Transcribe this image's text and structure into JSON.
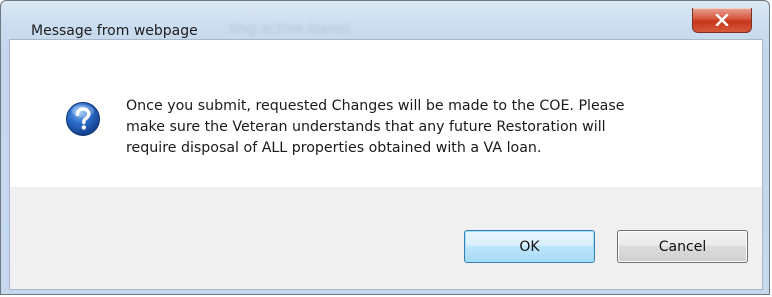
{
  "dialog": {
    "title": "Message from webpage",
    "title_ghost": "ting active loans)",
    "close_label": "x",
    "message_lines": [
      "Once you submit, requested Changes will be made to the COE. Please",
      "make sure the Veteran understands that any future Restoration will",
      "require disposal of ALL properties obtained with a VA loan."
    ],
    "icon": "question-icon",
    "buttons": {
      "ok_label": "OK",
      "cancel_label": "Cancel"
    }
  },
  "colors": {
    "close_button": "#c7361b",
    "ok_button_border": "#3c7fb1",
    "icon_blue": "#1f5bb0"
  }
}
